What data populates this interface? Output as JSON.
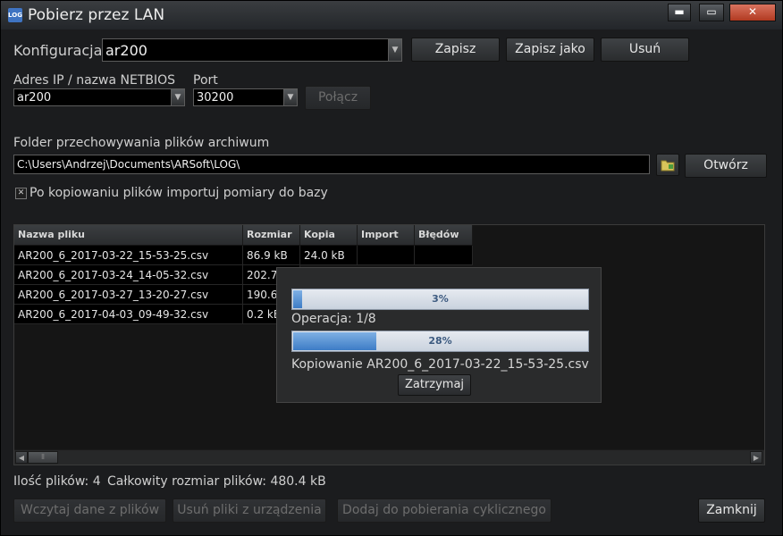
{
  "window": {
    "title": "Pobierz przez LAN",
    "icon_text": "LOG",
    "controls": {
      "minimize": "▬",
      "maximize": "▭",
      "close": "✕"
    }
  },
  "config": {
    "label": "Konfiguracja",
    "value": "ar200",
    "save_label": "Zapisz",
    "save_as_label": "Zapisz jako",
    "delete_label": "Usuń"
  },
  "connection": {
    "ip_label": "Adres IP / nazwa NETBIOS",
    "ip_value": "ar200",
    "port_label": "Port",
    "port_value": "30200",
    "connect_label": "Połącz"
  },
  "folder": {
    "label": "Folder przechowywania plików archiwum",
    "path": "C:\\Users\\Andrzej\\Documents\\ARSoft\\LOG\\",
    "browse_icon": "folder-icon",
    "open_label": "Otwórz"
  },
  "import_option": {
    "checked_mark": "✕",
    "label": "Po kopiowaniu plików importuj pomiary do bazy"
  },
  "table": {
    "columns": [
      "Nazwa pliku",
      "Rozmiar",
      "Kopia",
      "Import",
      "Błędów"
    ],
    "rows": [
      {
        "name": "AR200_6_2017-03-22_15-53-25.csv",
        "size": "86.9 kB",
        "copy": "24.0 kB",
        "import": "",
        "errors": ""
      },
      {
        "name": "AR200_6_2017-03-24_14-05-32.csv",
        "size": "202.7",
        "copy": "",
        "import": "",
        "errors": ""
      },
      {
        "name": "AR200_6_2017-03-27_13-20-27.csv",
        "size": "190.6",
        "copy": "",
        "import": "",
        "errors": ""
      },
      {
        "name": "AR200_6_2017-04-03_09-49-32.csv",
        "size": "0.2 kB",
        "copy": "",
        "import": "",
        "errors": ""
      }
    ],
    "scroll_left": "◀",
    "scroll_right": "▶",
    "scroll_grip": "⦀"
  },
  "progress": {
    "overall_percent": 3,
    "overall_text": "3%",
    "operation_text": "Operacja: 1/8",
    "file_percent": 28,
    "file_text": "28%",
    "copy_text": "Kopiowanie AR200_6_2017-03-22_15-53-25.csv",
    "stop_label": "Zatrzymaj"
  },
  "status": {
    "file_count": "Ilość plików: 4",
    "total_size": "Całkowity rozmiar plików: 480.4 kB"
  },
  "actions": {
    "load_label": "Wczytaj dane z plików",
    "remove_label": "Usuń pliki z urządzenia",
    "add_label": "Dodaj do pobierania cyklicznego",
    "close_label": "Zamknij"
  },
  "dropdown_arrow": "▼"
}
